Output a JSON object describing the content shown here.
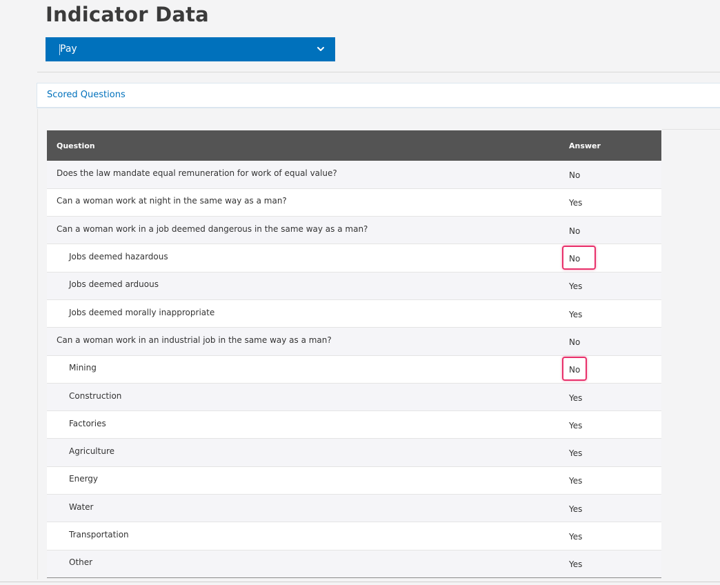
{
  "page": {
    "title": "Indicator Data"
  },
  "indicator_select": {
    "value": "Pay"
  },
  "tabs": [
    {
      "label": "Scored Questions"
    }
  ],
  "table": {
    "headers": {
      "question": "Question",
      "answer": "Answer"
    },
    "rows": [
      {
        "question": "Does the law mandate equal remuneration for work of equal value?",
        "answer": "No",
        "indent": false,
        "highlighted": false
      },
      {
        "question": "Can a woman work at night in the same way as a man?",
        "answer": "Yes",
        "indent": false,
        "highlighted": false
      },
      {
        "question": "Can a woman work in a job deemed dangerous in the same way as a man?",
        "answer": "No",
        "indent": false,
        "highlighted": false
      },
      {
        "question": "Jobs deemed hazardous",
        "answer": "No",
        "indent": true,
        "highlighted": true
      },
      {
        "question": "Jobs deemed arduous",
        "answer": "Yes",
        "indent": true,
        "highlighted": false
      },
      {
        "question": "Jobs deemed morally inappropriate",
        "answer": "Yes",
        "indent": true,
        "highlighted": false
      },
      {
        "question": "Can a woman work in an industrial job in the same way as a man?",
        "answer": "No",
        "indent": false,
        "highlighted": false
      },
      {
        "question": "Mining",
        "answer": "No",
        "indent": true,
        "highlighted": true
      },
      {
        "question": "Construction",
        "answer": "Yes",
        "indent": true,
        "highlighted": false
      },
      {
        "question": "Factories",
        "answer": "Yes",
        "indent": true,
        "highlighted": false
      },
      {
        "question": "Agriculture",
        "answer": "Yes",
        "indent": true,
        "highlighted": false
      },
      {
        "question": "Energy",
        "answer": "Yes",
        "indent": true,
        "highlighted": false
      },
      {
        "question": "Water",
        "answer": "Yes",
        "indent": true,
        "highlighted": false
      },
      {
        "question": "Transportation",
        "answer": "Yes",
        "indent": true,
        "highlighted": false
      },
      {
        "question": "Other",
        "answer": "Yes",
        "indent": true,
        "highlighted": false
      }
    ]
  },
  "colors": {
    "brand_blue": "#0071bc",
    "header_bg": "#545454",
    "highlight": "#e8306a"
  },
  "icons": {
    "select_chevron": "chevron-down-icon"
  }
}
